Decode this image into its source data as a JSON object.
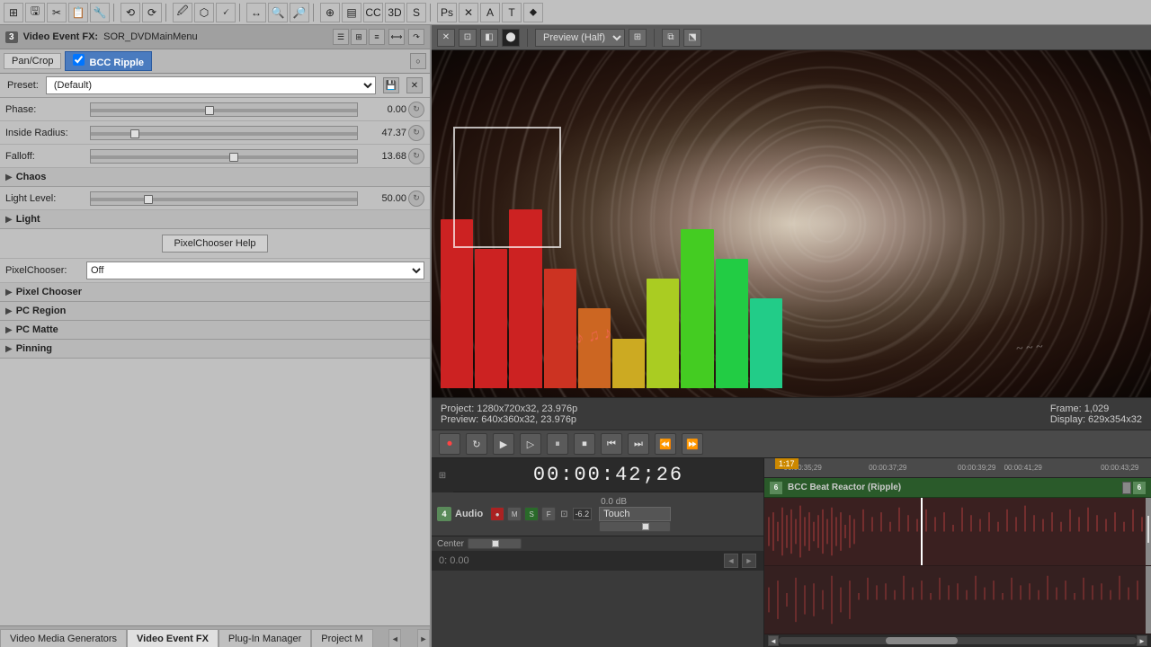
{
  "toolbar": {
    "items": [
      "⊞",
      "💾",
      "✂",
      "📋",
      "🔧",
      "⟲",
      "⟳"
    ]
  },
  "fx_panel": {
    "badge": "3",
    "title_label": "Video Event FX:",
    "event_name": "SOR_DVDMainMenu",
    "tabs": [
      {
        "label": "Pan/Crop",
        "active": false
      },
      {
        "label": "BCC Ripple",
        "active": true
      }
    ],
    "preset_label": "Preset:",
    "preset_value": "(Default)",
    "controls": [
      {
        "label": "Phase:",
        "value": "0.00",
        "thumb_pct": 45
      },
      {
        "label": "Inside Radius:",
        "value": "47.37",
        "thumb_pct": 22
      },
      {
        "label": "Falloff:",
        "value": "13.68",
        "thumb_pct": 55
      }
    ],
    "sections": [
      "Chaos",
      "Light"
    ],
    "light_level_label": "Light Level:",
    "light_level_value": "50.00",
    "light_level_thumb": 25,
    "pixelchooser_help_btn": "PixelChooser Help",
    "pixelchooser_label": "PixelChooser:",
    "pixelchooser_value": "Off",
    "sub_sections": [
      "Pixel Chooser",
      "PC Region",
      "PC Matte",
      "Pinning"
    ]
  },
  "bottom_tabs": [
    {
      "label": "Video Media Generators",
      "active": false
    },
    {
      "label": "Video Event FX",
      "active": true
    },
    {
      "label": "Plug-In Manager",
      "active": false
    },
    {
      "label": "Project M",
      "active": false
    }
  ],
  "preview": {
    "dropdown_label": "Preview (Half)",
    "status_project": "Project:  1280x720x32, 23.976p",
    "status_preview": "Preview:  640x360x32, 23.976p",
    "status_frame": "Frame:   1,029",
    "status_display": "Display:  629x354x32"
  },
  "timeline": {
    "timecode": "00:00:42;26",
    "marker_label": "1:17",
    "ruler_marks": [
      {
        "time": "00:00:35;29",
        "pct": 0
      },
      {
        "time": "00:00:37;29",
        "pct": 25
      },
      {
        "time": "00:00:39;29",
        "pct": 50
      },
      {
        "time": "00:00:41;29",
        "pct": 63
      },
      {
        "time": "00:00:43;29",
        "pct": 88
      }
    ],
    "bcc_track_label": "BCC Beat Reactor (Ripple)",
    "bcc_num_left": "6",
    "bcc_num_right": "6"
  },
  "audio_track": {
    "number": "4",
    "label": "Audio",
    "volume": "0.0 dB",
    "pan": "Center",
    "touch_label": "Touch",
    "db_value": "-6.2"
  },
  "bottom_timecode": {
    "value": "0: 0.00",
    "nav_label": "◄►"
  }
}
